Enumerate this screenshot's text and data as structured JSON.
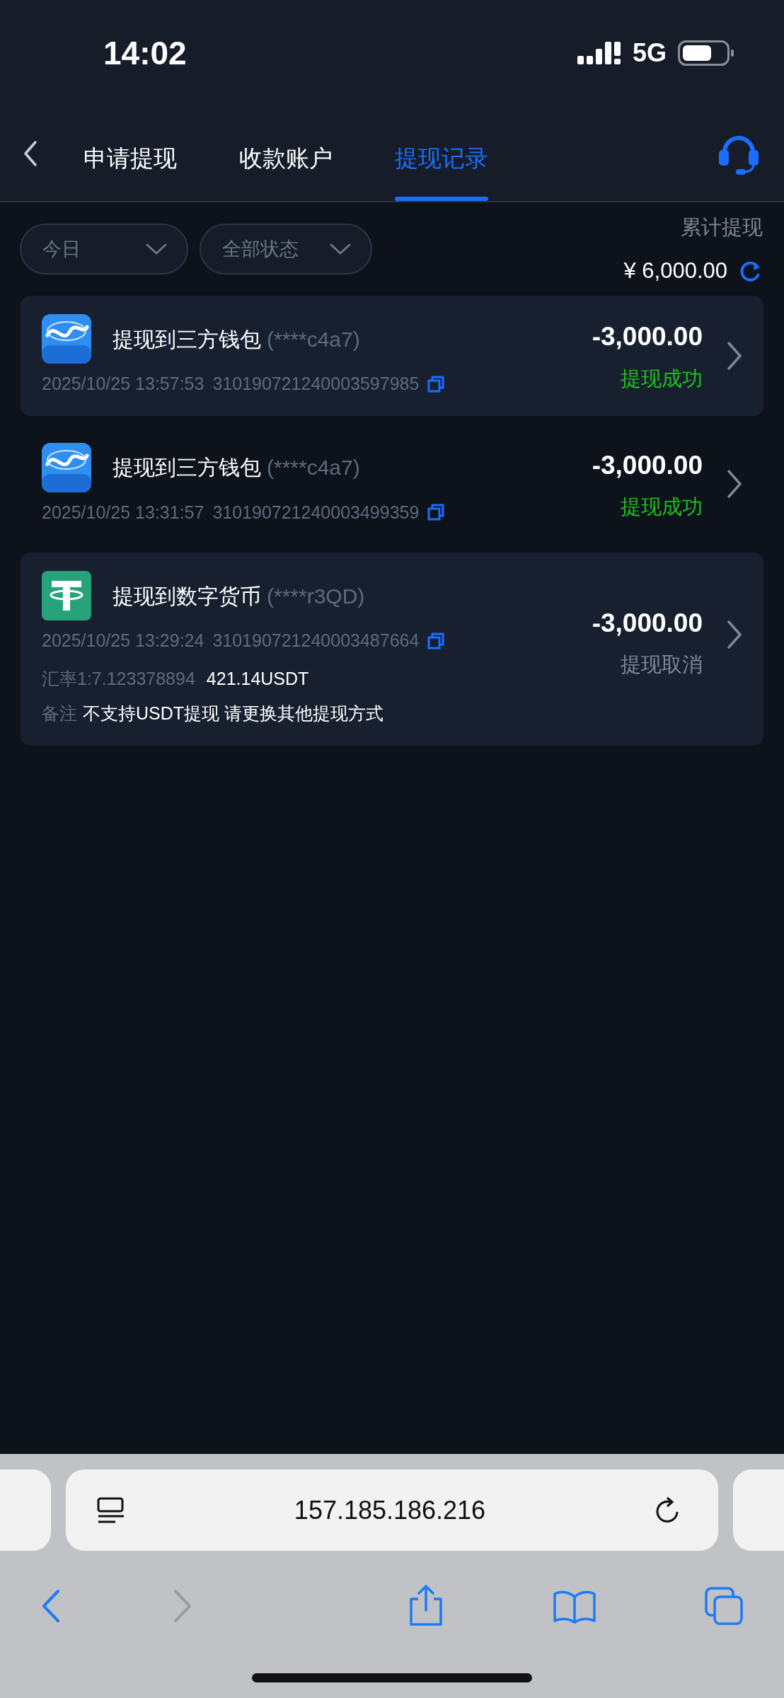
{
  "status_bar": {
    "time": "14:02",
    "network": "5G"
  },
  "tabs": [
    {
      "label": "申请提现",
      "selected": false
    },
    {
      "label": "收款账户",
      "selected": false
    },
    {
      "label": "提现记录",
      "selected": true
    }
  ],
  "filters": [
    {
      "label": "今日"
    },
    {
      "label": "全部状态"
    }
  ],
  "total": {
    "label": "累计提现",
    "amount": "¥ 6,000.00"
  },
  "records": [
    {
      "kind": "wallet",
      "shaded": true,
      "title": "提现到三方钱包",
      "account": "(****c4a7)",
      "time": "2025/10/25 13:57:53",
      "order_no": "310190721240003597985",
      "amount": "-3,000.00",
      "status": {
        "text": "提现成功",
        "kind": "success"
      }
    },
    {
      "kind": "wallet",
      "shaded": false,
      "title": "提现到三方钱包",
      "account": "(****c4a7)",
      "time": "2025/10/25 13:31:57",
      "order_no": "310190721240003499359",
      "amount": "-3,000.00",
      "status": {
        "text": "提现成功",
        "kind": "success"
      }
    },
    {
      "kind": "crypto",
      "shaded": true,
      "title": "提现到数字货币",
      "account": "(****r3QD)",
      "time": "2025/10/25 13:29:24",
      "order_no": "310190721240003487664",
      "amount": "-3,000.00",
      "status": {
        "text": "提现取消",
        "kind": "cancelled"
      },
      "rate": "汇率1:7.123378894",
      "usdt": "421.14USDT",
      "remark_label": "备注",
      "remark": "不支持USDT提现 请更换其他提现方式"
    }
  ],
  "browser": {
    "url": "157.185.186.216",
    "back_disabled": false,
    "forward_disabled": true
  }
}
